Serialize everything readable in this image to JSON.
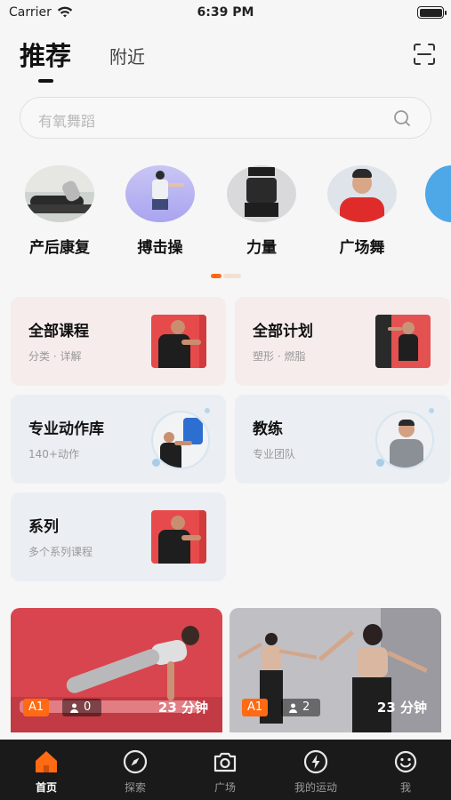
{
  "status": {
    "carrier": "Carrier",
    "time": "6:39 PM"
  },
  "header": {
    "tab_recommend": "推荐",
    "tab_nearby": "附近"
  },
  "search": {
    "placeholder": "有氧舞蹈"
  },
  "categories": [
    {
      "label": "产后康复"
    },
    {
      "label": "搏击操"
    },
    {
      "label": "力量"
    },
    {
      "label": "广场舞"
    }
  ],
  "cards": [
    {
      "title": "全部课程",
      "sub": "分类 · 详解"
    },
    {
      "title": "全部计划",
      "sub": "塑形 · 燃脂"
    },
    {
      "title": "专业动作库",
      "sub": "140+动作"
    },
    {
      "title": "教练",
      "sub": "专业团队"
    },
    {
      "title": "系列",
      "sub": "多个系列课程"
    }
  ],
  "videos": [
    {
      "level": "A1",
      "people": "0",
      "duration": "23 分钟"
    },
    {
      "level": "A1",
      "people": "2",
      "duration": "23 分钟"
    }
  ],
  "nav": [
    {
      "label": "首页",
      "icon": "home-icon"
    },
    {
      "label": "探索",
      "icon": "compass-icon"
    },
    {
      "label": "广场",
      "icon": "camera-icon"
    },
    {
      "label": "我的运动",
      "icon": "bolt-icon"
    },
    {
      "label": "我",
      "icon": "smile-icon"
    }
  ],
  "colors": {
    "accent": "#ff6a13",
    "nav_bg": "#1a1a1a",
    "card_pink": "#f6ecec",
    "card_blue": "#ebeef3"
  }
}
